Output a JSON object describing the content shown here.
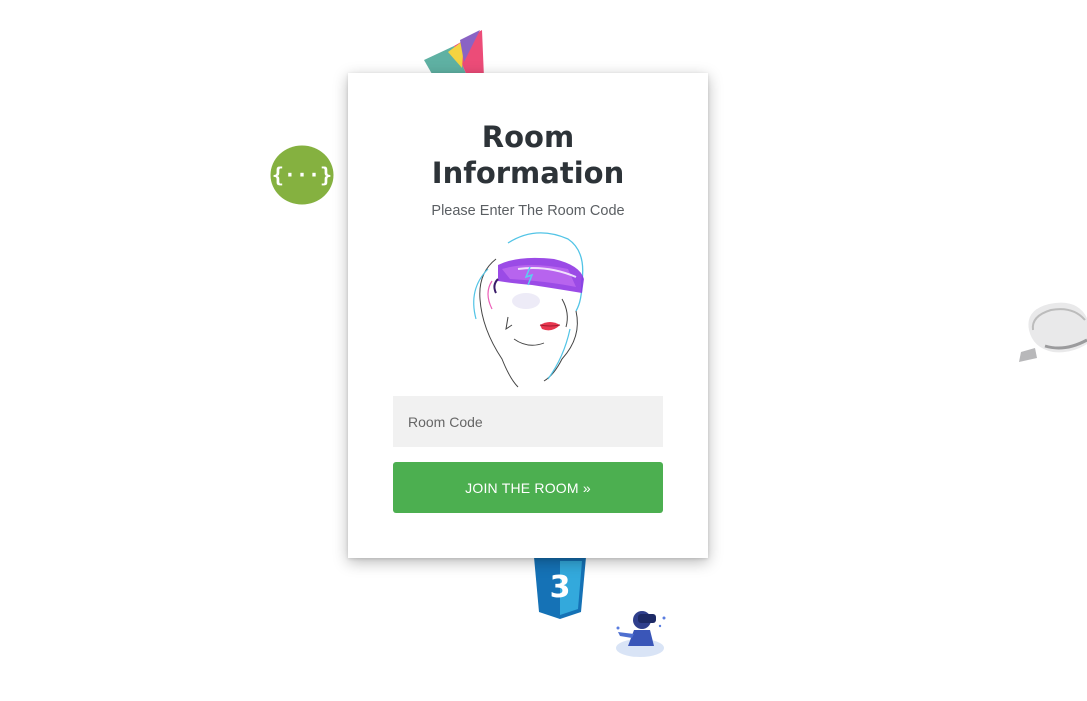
{
  "card": {
    "title": "Room Information",
    "subtitle": "Please Enter The Room Code"
  },
  "form": {
    "room_code_placeholder": "Room Code",
    "join_label": "JOIN THE ROOM »"
  },
  "decorations": {
    "icons": [
      "polygon-logo-icon",
      "swagger-logo-icon",
      "vr-headset-icon",
      "css3-logo-icon",
      "vr-user-icon"
    ]
  },
  "colors": {
    "button": "#4caf50",
    "swagger": "#85b140",
    "css3": "#2965f1",
    "title": "#2d3338"
  }
}
